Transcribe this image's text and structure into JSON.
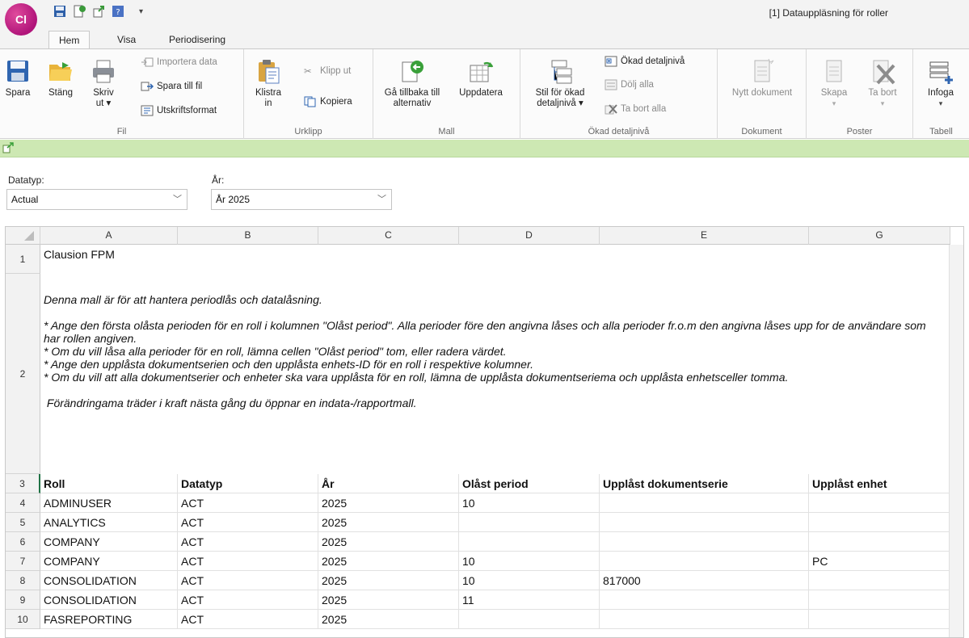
{
  "app": {
    "logo_text": "Cl",
    "window_title": "[1] Datauppläsning för roller"
  },
  "tabs": [
    "Hem",
    "Visa",
    "Periodisering"
  ],
  "ribbon": {
    "fil": {
      "label": "Fil",
      "spara": "Spara",
      "stang": "Stäng",
      "skriv_ut": "Skriv ut ▾",
      "importera_data": "Importera data",
      "spara_till_fil": "Spara till fil",
      "utskriftsformat": "Utskriftsformat"
    },
    "urklipp": {
      "label": "Urklipp",
      "klistra_in": "Klistra in",
      "klipp_ut": "Klipp ut",
      "kopiera": "Kopiera"
    },
    "mall": {
      "label": "Mall",
      "ga_tillbaka": "Gå tillbaka till alternativ",
      "uppdatera": "Uppdatera"
    },
    "okad": {
      "label": "Ökad detaljnivå",
      "stil": "Stil för ökad detaljnivå ▾",
      "okad_detaljniva": "Ökad detaljnivå",
      "dolj_alla": "Dölj alla",
      "ta_bort_alla": "Ta bort alla"
    },
    "dokument": {
      "label": "Dokument",
      "nytt": "Nytt dokument"
    },
    "poster": {
      "label": "Poster",
      "skapa": "Skapa",
      "ta_bort": "Ta bort"
    },
    "tabell": {
      "label": "Tabell",
      "infoga": "Infoga"
    }
  },
  "filters": {
    "datatyp_label": "Datatyp:",
    "datatyp_value": "Actual",
    "ar_label": "År:",
    "ar_value": "År 2025"
  },
  "sheet": {
    "columns": [
      "A",
      "B",
      "C",
      "D",
      "E",
      "G"
    ],
    "row_numbers": [
      "1",
      "2",
      "3",
      "4",
      "5",
      "6",
      "7",
      "8",
      "9",
      "10"
    ],
    "title": "Clausion FPM",
    "description": [
      "Denna mall är för att hantera periodlås och datalåsning.",
      "* Ange den första olåsta perioden för en roll i kolumnen \"Olåst period\". Alla perioder före den angivna låses och alla perioder fr.o.m den angivna låses upp for de användare som har rollen angiven.",
      "* Om du vill låsa alla perioder för en roll, lämna cellen \"Olåst period\" tom, eller radera värdet.",
      "* Ange den upplåsta dokumentserien och den upplåsta enhets-ID för en roll i respektive kolumner.",
      "* Om du vill att alla dokumentserier och enheter ska vara upplåsta för en roll, lämna de upplåsta dokumentseriema och upplåsta enhetsceller tomma.",
      " Förändringama träder i kraft nästa gång du öppnar en indata-/rapportmall."
    ],
    "headers": [
      "Roll",
      "Datatyp",
      "År",
      "Olåst period",
      "Upplåst dokumentserie",
      "Upplåst enhet"
    ],
    "rows": [
      [
        "ADMINUSER",
        "ACT",
        "2025",
        "10",
        "",
        ""
      ],
      [
        "ANALYTICS",
        "ACT",
        "2025",
        "",
        "",
        ""
      ],
      [
        "COMPANY",
        "ACT",
        "2025",
        "",
        "",
        ""
      ],
      [
        "COMPANY",
        "ACT",
        "2025",
        "10",
        "",
        "PC"
      ],
      [
        "CONSOLIDATION",
        "ACT",
        "2025",
        "10",
        "817000",
        ""
      ],
      [
        "CONSOLIDATION",
        "ACT",
        "2025",
        "11",
        "",
        ""
      ],
      [
        "FASREPORTING",
        "ACT",
        "2025",
        "",
        "",
        ""
      ]
    ]
  }
}
